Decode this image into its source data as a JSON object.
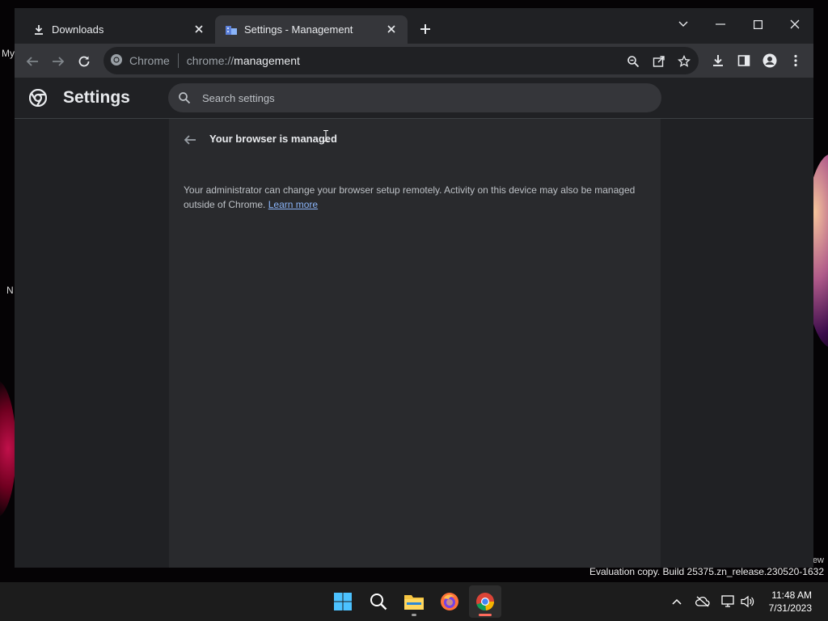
{
  "desktop": {
    "icon_labels": [
      "My",
      "N"
    ],
    "eval_side_text": "ew",
    "eval_text": "Evaluation copy. Build 25375.zn_release.230520-1632"
  },
  "browser": {
    "tabs": [
      {
        "label": "Downloads",
        "icon": "download-icon",
        "active": false
      },
      {
        "label": "Settings - Management",
        "icon": "management-icon",
        "active": true
      }
    ],
    "omnibox": {
      "chip_label": "Chrome",
      "url_scheme": "chrome://",
      "url_path": "management"
    }
  },
  "settings": {
    "title": "Settings",
    "search_placeholder": "Search settings",
    "page_heading": "Your browser is managed",
    "description": "Your administrator can change your browser setup remotely. Activity on this device may also be managed outside of Chrome.",
    "learn_more": "Learn more"
  },
  "taskbar": {
    "apps": [
      "start-icon",
      "search-icon",
      "file-explorer-icon",
      "firefox-icon",
      "chrome-icon"
    ],
    "time": "11:48 AM",
    "date": "7/31/2023"
  },
  "colors": {
    "accent_link": "#8ab4f8",
    "window_bg": "#202124",
    "content_bg": "#292a2d"
  }
}
